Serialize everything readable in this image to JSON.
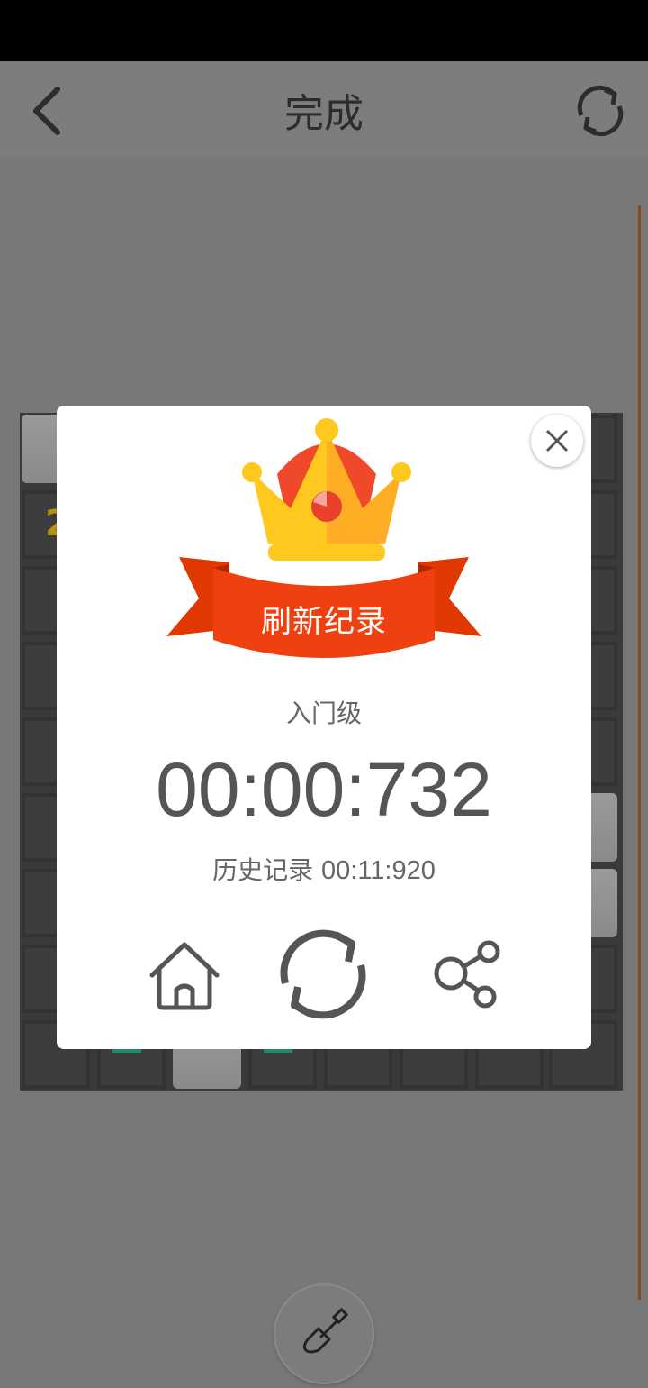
{
  "header": {
    "title": "完成",
    "back_icon": "chevron-left-icon",
    "refresh_icon": "refresh-icon"
  },
  "board": {
    "visible_number": "2",
    "number_color": "#b8900a",
    "flag_color": "#1e8b6a"
  },
  "dialog": {
    "banner_text": "刷新纪录",
    "level": "入门级",
    "time": "00:00:732",
    "history_label": "历史记录",
    "history_value": "00:11:920",
    "actions": [
      "home-icon",
      "restart-icon",
      "share-icon"
    ],
    "close_icon": "close-icon"
  },
  "tool": {
    "icon": "shovel-icon"
  },
  "colors": {
    "ribbon": "#f04010",
    "crown_gold": "#ffc81f",
    "crown_red": "#f0482a"
  }
}
